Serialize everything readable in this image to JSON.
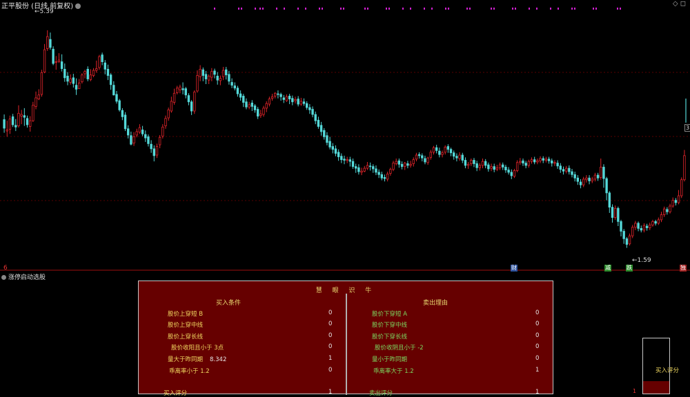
{
  "window": {
    "title": "正平股份 (日线,前复权)",
    "top_right": "◇ ◻"
  },
  "chart_data": {
    "type": "candlestick",
    "price_range": [
      1.2,
      5.75
    ],
    "high_marker": "5.39",
    "low_marker": "1.59",
    "edge_price": "3.",
    "candles": [
      [
        3.83,
        3.68,
        3.92,
        3.6
      ],
      [
        3.63,
        3.65,
        3.81,
        3.53
      ],
      [
        3.66,
        3.84,
        3.9,
        3.58
      ],
      [
        3.88,
        3.74,
        3.93,
        3.7
      ],
      [
        3.73,
        3.7,
        3.84,
        3.63
      ],
      [
        3.72,
        3.94,
        4.08,
        3.69
      ],
      [
        3.89,
        3.92,
        4.0,
        3.75
      ],
      [
        3.9,
        3.87,
        4.03,
        3.72
      ],
      [
        3.85,
        3.74,
        3.9,
        3.69
      ],
      [
        3.71,
        3.81,
        3.89,
        3.62
      ],
      [
        3.81,
        4.08,
        4.14,
        3.79
      ],
      [
        4.06,
        4.21,
        4.32,
        4.01
      ],
      [
        4.19,
        4.26,
        4.36,
        4.17
      ],
      [
        4.27,
        4.65,
        4.7,
        4.23
      ],
      [
        4.66,
        5.05,
        5.15,
        4.64
      ],
      [
        5.07,
        5.28,
        5.39,
        5.03
      ],
      [
        5.23,
        5.09,
        5.35,
        5.05
      ],
      [
        5.06,
        4.81,
        5.11,
        4.78
      ],
      [
        4.84,
        4.84,
        4.94,
        4.7
      ],
      [
        4.84,
        4.87,
        4.99,
        4.82
      ],
      [
        4.84,
        4.72,
        4.97,
        4.67
      ],
      [
        4.71,
        4.56,
        4.81,
        4.49
      ],
      [
        4.59,
        4.5,
        4.66,
        4.43
      ],
      [
        4.48,
        4.54,
        4.62,
        4.44
      ],
      [
        4.56,
        4.46,
        4.63,
        4.39
      ],
      [
        4.43,
        4.36,
        4.55,
        4.26
      ],
      [
        4.37,
        4.47,
        4.54,
        4.37
      ],
      [
        4.49,
        4.61,
        4.64,
        4.46
      ],
      [
        4.63,
        4.67,
        4.7,
        4.55
      ],
      [
        4.71,
        4.54,
        4.76,
        4.5
      ],
      [
        4.53,
        4.61,
        4.71,
        4.5
      ],
      [
        4.6,
        4.69,
        4.73,
        4.57
      ],
      [
        4.69,
        4.72,
        4.86,
        4.65
      ],
      [
        4.74,
        4.93,
        4.96,
        4.7
      ],
      [
        4.96,
        4.84,
        5.0,
        4.78
      ],
      [
        4.82,
        4.71,
        4.87,
        4.62
      ],
      [
        4.71,
        4.6,
        4.79,
        4.52
      ],
      [
        4.61,
        4.44,
        4.64,
        4.35
      ],
      [
        4.43,
        4.26,
        4.5,
        4.25
      ],
      [
        4.27,
        4.15,
        4.33,
        4.11
      ],
      [
        4.16,
        4.0,
        4.19,
        3.97
      ],
      [
        3.99,
        3.88,
        4.03,
        3.82
      ],
      [
        3.91,
        3.67,
        3.96,
        3.63
      ],
      [
        3.67,
        3.56,
        3.73,
        3.5
      ],
      [
        3.55,
        3.4,
        3.62,
        3.38
      ],
      [
        3.42,
        3.53,
        3.61,
        3.37
      ],
      [
        3.56,
        3.62,
        3.67,
        3.52
      ],
      [
        3.61,
        3.69,
        3.75,
        3.58
      ],
      [
        3.65,
        3.58,
        3.72,
        3.54
      ],
      [
        3.57,
        3.51,
        3.64,
        3.44
      ],
      [
        3.53,
        3.41,
        3.57,
        3.36
      ],
      [
        3.4,
        3.32,
        3.47,
        3.25
      ],
      [
        3.32,
        3.2,
        3.38,
        3.1
      ],
      [
        3.21,
        3.36,
        3.41,
        3.16
      ],
      [
        3.39,
        3.52,
        3.56,
        3.33
      ],
      [
        3.54,
        3.7,
        3.75,
        3.5
      ],
      [
        3.72,
        3.85,
        3.9,
        3.67
      ],
      [
        3.86,
        4.0,
        4.04,
        3.81
      ],
      [
        3.98,
        4.15,
        4.23,
        3.95
      ],
      [
        4.13,
        4.29,
        4.37,
        4.09
      ],
      [
        4.3,
        4.38,
        4.42,
        4.27
      ],
      [
        4.35,
        4.4,
        4.44,
        4.29
      ],
      [
        4.37,
        4.35,
        4.48,
        4.27
      ],
      [
        4.37,
        4.26,
        4.4,
        4.2
      ],
      [
        4.25,
        4.14,
        4.29,
        4.08
      ],
      [
        4.14,
        3.98,
        4.17,
        3.91
      ],
      [
        3.98,
        4.31,
        4.34,
        3.93
      ],
      [
        4.33,
        4.6,
        4.69,
        4.3
      ],
      [
        4.58,
        4.71,
        4.78,
        4.5
      ],
      [
        4.7,
        4.6,
        4.74,
        4.5
      ],
      [
        4.62,
        4.54,
        4.68,
        4.45
      ],
      [
        4.52,
        4.59,
        4.62,
        4.45
      ],
      [
        4.57,
        4.67,
        4.73,
        4.5
      ],
      [
        4.68,
        4.62,
        4.72,
        4.55
      ],
      [
        4.59,
        4.52,
        4.66,
        4.44
      ],
      [
        4.51,
        4.55,
        4.6,
        4.43
      ],
      [
        4.58,
        4.69,
        4.75,
        4.52
      ],
      [
        4.7,
        4.61,
        4.75,
        4.53
      ],
      [
        4.62,
        4.5,
        4.68,
        4.44
      ],
      [
        4.48,
        4.43,
        4.55,
        4.38
      ],
      [
        4.42,
        4.38,
        4.48,
        4.34
      ],
      [
        4.38,
        4.28,
        4.42,
        4.23
      ],
      [
        4.28,
        4.22,
        4.34,
        4.16
      ],
      [
        4.24,
        4.13,
        4.28,
        4.05
      ],
      [
        4.14,
        4.05,
        4.2,
        4.01
      ],
      [
        4.05,
        4.09,
        4.14,
        4.01
      ],
      [
        4.12,
        4.06,
        4.17,
        3.98
      ],
      [
        4.07,
        4.0,
        4.1,
        3.95
      ],
      [
        4.01,
        3.89,
        4.05,
        3.84
      ],
      [
        3.9,
        3.93,
        4.0,
        3.86
      ],
      [
        3.92,
        4.03,
        4.07,
        3.88
      ],
      [
        4.03,
        4.11,
        4.15,
        3.96
      ],
      [
        4.1,
        4.19,
        4.23,
        4.06
      ],
      [
        4.2,
        4.23,
        4.28,
        4.16
      ],
      [
        4.24,
        4.29,
        4.31,
        4.2
      ],
      [
        4.28,
        4.27,
        4.34,
        4.2
      ],
      [
        4.27,
        4.23,
        4.3,
        4.16
      ],
      [
        4.21,
        4.18,
        4.26,
        4.12
      ],
      [
        4.16,
        4.23,
        4.27,
        4.14
      ],
      [
        4.24,
        4.19,
        4.28,
        4.1
      ],
      [
        4.2,
        4.14,
        4.25,
        4.08
      ],
      [
        4.16,
        4.18,
        4.23,
        4.11
      ],
      [
        4.19,
        4.1,
        4.24,
        4.06
      ],
      [
        4.1,
        4.15,
        4.21,
        4.07
      ],
      [
        4.14,
        4.11,
        4.2,
        4.07
      ],
      [
        4.11,
        4.04,
        4.15,
        4.0
      ],
      [
        4.04,
        4.0,
        4.1,
        3.93
      ],
      [
        4.01,
        3.92,
        4.06,
        3.87
      ],
      [
        3.92,
        3.81,
        3.97,
        3.75
      ],
      [
        3.82,
        3.71,
        3.88,
        3.67
      ],
      [
        3.73,
        3.62,
        3.79,
        3.55
      ],
      [
        3.64,
        3.53,
        3.68,
        3.48
      ],
      [
        3.55,
        3.43,
        3.61,
        3.38
      ],
      [
        3.45,
        3.35,
        3.53,
        3.31
      ],
      [
        3.36,
        3.31,
        3.42,
        3.24
      ],
      [
        3.32,
        3.24,
        3.38,
        3.19
      ],
      [
        3.26,
        3.18,
        3.31,
        3.11
      ],
      [
        3.19,
        3.13,
        3.24,
        3.07
      ],
      [
        3.14,
        3.12,
        3.2,
        3.05
      ],
      [
        3.13,
        3.13,
        3.18,
        3.07
      ],
      [
        3.13,
        3.1,
        3.18,
        3.01
      ],
      [
        3.1,
        3.01,
        3.15,
        2.97
      ],
      [
        3.01,
        2.98,
        3.06,
        2.9
      ],
      [
        2.99,
        2.92,
        3.05,
        2.87
      ],
      [
        2.91,
        2.93,
        2.99,
        2.86
      ],
      [
        2.93,
        2.98,
        3.02,
        2.91
      ],
      [
        2.98,
        3.03,
        3.09,
        2.95
      ],
      [
        3.02,
        3.01,
        3.08,
        2.94
      ],
      [
        3.01,
        2.97,
        3.05,
        2.9
      ],
      [
        2.97,
        2.91,
        3.03,
        2.86
      ],
      [
        2.91,
        2.87,
        2.96,
        2.81
      ],
      [
        2.87,
        2.81,
        2.92,
        2.77
      ],
      [
        2.82,
        2.8,
        2.87,
        2.75
      ],
      [
        2.79,
        2.88,
        2.92,
        2.75
      ],
      [
        2.89,
        2.96,
        2.99,
        2.85
      ],
      [
        2.96,
        3.07,
        3.11,
        2.93
      ],
      [
        3.06,
        3.1,
        3.15,
        3.03
      ],
      [
        3.11,
        3.05,
        3.15,
        2.99
      ],
      [
        3.05,
        3.01,
        3.1,
        2.96
      ],
      [
        3.01,
        3.07,
        3.09,
        2.95
      ],
      [
        3.06,
        3.03,
        3.11,
        2.98
      ],
      [
        3.03,
        3.05,
        3.11,
        2.99
      ],
      [
        3.06,
        3.13,
        3.17,
        3.01
      ],
      [
        3.14,
        3.21,
        3.25,
        3.1
      ],
      [
        3.22,
        3.2,
        3.26,
        3.15
      ],
      [
        3.2,
        3.16,
        3.24,
        3.1
      ],
      [
        3.15,
        3.09,
        3.2,
        3.05
      ],
      [
        3.08,
        3.16,
        3.18,
        3.04
      ],
      [
        3.17,
        3.26,
        3.3,
        3.13
      ],
      [
        3.26,
        3.34,
        3.37,
        3.22
      ],
      [
        3.34,
        3.29,
        3.39,
        3.24
      ],
      [
        3.28,
        3.22,
        3.34,
        3.17
      ],
      [
        3.22,
        3.25,
        3.29,
        3.17
      ],
      [
        3.26,
        3.35,
        3.38,
        3.22
      ],
      [
        3.36,
        3.31,
        3.4,
        3.25
      ],
      [
        3.31,
        3.25,
        3.34,
        3.19
      ],
      [
        3.25,
        3.19,
        3.29,
        3.13
      ],
      [
        3.19,
        3.16,
        3.24,
        3.1
      ],
      [
        3.15,
        3.21,
        3.26,
        3.11
      ],
      [
        3.21,
        3.12,
        3.25,
        3.07
      ],
      [
        3.12,
        3.03,
        3.17,
        2.98
      ],
      [
        3.03,
        3.05,
        3.09,
        2.97
      ],
      [
        3.06,
        3.12,
        3.15,
        3.02
      ],
      [
        3.12,
        3.06,
        3.16,
        3.0
      ],
      [
        3.06,
        2.99,
        3.11,
        2.93
      ],
      [
        2.99,
        3.03,
        3.07,
        2.94
      ],
      [
        3.03,
        3.1,
        3.15,
        2.98
      ],
      [
        3.1,
        3.03,
        3.14,
        2.98
      ],
      [
        3.04,
        2.97,
        3.08,
        2.92
      ],
      [
        2.98,
        3.01,
        3.06,
        2.93
      ],
      [
        3.01,
        2.96,
        3.06,
        2.91
      ],
      [
        2.96,
        2.99,
        3.04,
        2.93
      ],
      [
        2.99,
        3.04,
        3.08,
        2.95
      ],
      [
        3.04,
        3.0,
        3.08,
        2.95
      ],
      [
        3.0,
        2.95,
        3.04,
        2.9
      ],
      [
        2.95,
        2.91,
        3.0,
        2.87
      ],
      [
        2.91,
        2.85,
        2.96,
        2.79
      ],
      [
        2.84,
        2.94,
        2.97,
        2.81
      ],
      [
        2.94,
        3.08,
        3.12,
        2.91
      ],
      [
        3.08,
        3.1,
        3.16,
        3.04
      ],
      [
        3.11,
        3.07,
        3.15,
        3.02
      ],
      [
        3.07,
        3.03,
        3.11,
        2.98
      ],
      [
        3.03,
        3.1,
        3.13,
        2.99
      ],
      [
        3.1,
        3.13,
        3.17,
        3.06
      ],
      [
        3.13,
        3.09,
        3.18,
        3.05
      ],
      [
        3.09,
        3.11,
        3.15,
        3.05
      ],
      [
        3.11,
        3.15,
        3.19,
        3.07
      ],
      [
        3.15,
        3.12,
        3.19,
        3.07
      ],
      [
        3.12,
        3.14,
        3.18,
        3.08
      ],
      [
        3.14,
        3.11,
        3.18,
        3.06
      ],
      [
        3.11,
        3.07,
        3.15,
        3.01
      ],
      [
        3.07,
        3.08,
        3.12,
        3.02
      ],
      [
        3.07,
        3.02,
        3.12,
        2.97
      ],
      [
        3.02,
        2.96,
        3.07,
        2.9
      ],
      [
        2.96,
        2.93,
        3.01,
        2.87
      ],
      [
        2.93,
        2.98,
        3.02,
        2.89
      ],
      [
        2.98,
        2.92,
        3.03,
        2.87
      ],
      [
        2.92,
        2.87,
        2.97,
        2.82
      ],
      [
        2.87,
        2.81,
        2.92,
        2.75
      ],
      [
        2.81,
        2.75,
        2.86,
        2.69
      ],
      [
        2.74,
        2.69,
        2.79,
        2.63
      ],
      [
        2.69,
        2.79,
        2.83,
        2.65
      ],
      [
        2.78,
        2.81,
        2.86,
        2.73
      ],
      [
        2.81,
        2.76,
        2.86,
        2.7
      ],
      [
        2.76,
        2.79,
        2.83,
        2.72
      ],
      [
        2.79,
        2.86,
        2.9,
        2.75
      ],
      [
        2.86,
        2.81,
        2.9,
        2.76
      ],
      [
        2.82,
        3.0,
        3.15,
        2.78
      ],
      [
        3.0,
        2.8,
        3.05,
        2.64
      ],
      [
        2.8,
        2.55,
        2.83,
        2.42
      ],
      [
        2.55,
        2.3,
        2.58,
        2.2
      ],
      [
        2.3,
        2.12,
        2.35,
        2.03
      ],
      [
        2.12,
        2.28,
        2.33,
        2.08
      ],
      [
        2.28,
        2.05,
        2.31,
        1.97
      ],
      [
        2.05,
        1.88,
        2.08,
        1.79
      ],
      [
        1.88,
        1.75,
        1.92,
        1.66
      ],
      [
        1.75,
        1.65,
        1.78,
        1.59
      ],
      [
        1.66,
        1.8,
        1.84,
        1.63
      ],
      [
        1.8,
        1.95,
        1.99,
        1.76
      ],
      [
        1.95,
        2.02,
        2.06,
        1.9
      ],
      [
        2.02,
        1.93,
        2.05,
        1.88
      ],
      [
        1.93,
        1.9,
        1.98,
        1.86
      ],
      [
        1.9,
        1.98,
        2.02,
        1.86
      ],
      [
        1.97,
        1.94,
        2.01,
        1.89
      ],
      [
        1.94,
        1.99,
        2.03,
        1.9
      ],
      [
        1.99,
        2.05,
        2.08,
        1.96
      ],
      [
        2.05,
        2.02,
        2.08,
        1.98
      ],
      [
        2.02,
        2.08,
        2.12,
        1.99
      ],
      [
        2.08,
        2.17,
        2.22,
        2.04
      ],
      [
        2.17,
        2.27,
        2.31,
        2.13
      ],
      [
        2.26,
        2.22,
        2.3,
        2.17
      ],
      [
        2.22,
        2.32,
        2.36,
        2.19
      ],
      [
        2.32,
        2.42,
        2.47,
        2.29
      ],
      [
        2.42,
        2.38,
        2.46,
        2.33
      ],
      [
        2.38,
        2.5,
        2.6,
        2.35
      ],
      [
        2.5,
        2.78,
        2.82,
        2.46
      ],
      [
        2.78,
        3.2,
        3.3,
        2.75
      ]
    ],
    "markers": [
      "财",
      "减",
      "跌",
      "独"
    ],
    "signal_count": 40
  },
  "left_tag": "6",
  "indicator": {
    "name": "涨停启动选股",
    "panel_title": "慧 眼 识 牛",
    "buy_header": "买入条件",
    "sell_header": "卖出理由",
    "buy_rows": [
      {
        "label": "股价上穿短 B",
        "value": "0"
      },
      {
        "label": "股价上穿中线",
        "value": "0"
      },
      {
        "label": "股价上穿长线",
        "value": "0"
      },
      {
        "label": "股价收阳且小于 3点",
        "value": "0"
      },
      {
        "label": "量大于昨同期",
        "extra": "8.342",
        "value": "1"
      },
      {
        "label": "乖离率小于 1.2",
        "value": "0"
      }
    ],
    "sell_rows": [
      {
        "label": "股价下穿短 A",
        "value": "0"
      },
      {
        "label": "股价下穿中线",
        "value": "0"
      },
      {
        "label": "股价下穿长线",
        "value": "0"
      },
      {
        "label": "股价收阴且小于 -2",
        "value": "0"
      },
      {
        "label": "量小于昨同期",
        "value": "0"
      },
      {
        "label": "乖离率大于 1.2",
        "value": "1"
      }
    ],
    "buy_score_label": "买入评分",
    "buy_score_value": "1",
    "sell_score_label": "卖出评分",
    "sell_score_value": "1",
    "gauge_label": "买入评分",
    "gauge_side_value": "1",
    "gauge_fill": 0.22
  },
  "colors": {
    "up": "#e0242a",
    "down": "#54d8d8",
    "grid": "#5a0000",
    "signal": "#d020d0",
    "panel_bg": "#660000"
  }
}
